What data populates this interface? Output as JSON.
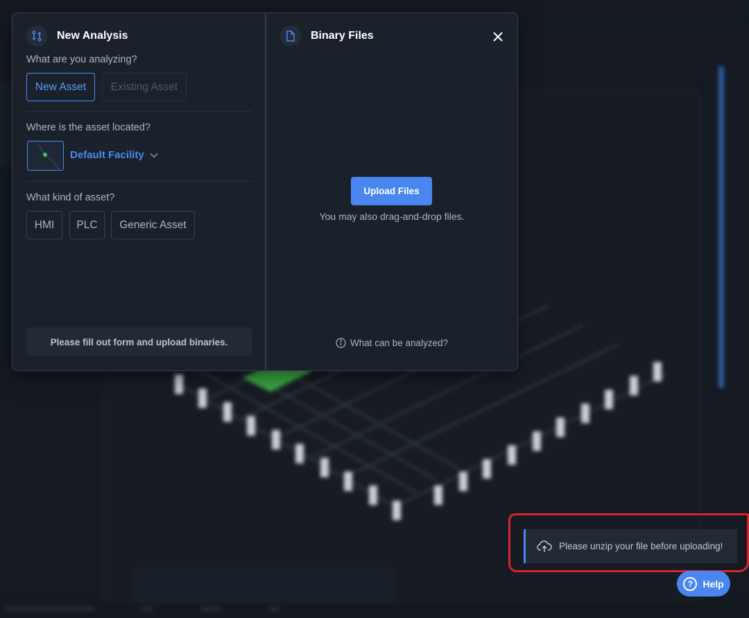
{
  "modal": {
    "left": {
      "title": "New Analysis",
      "q_analyzing": "What are you analyzing?",
      "new_asset_label": "New Asset",
      "existing_asset_label": "Existing Asset",
      "q_location": "Where is the asset located?",
      "facility_label": "Default Facility",
      "q_kind": "What kind of asset?",
      "asset_types": [
        "HMI",
        "PLC",
        "Generic Asset"
      ],
      "status_text": "Please fill out form and upload binaries."
    },
    "right": {
      "title": "Binary Files",
      "upload_label": "Upload Files",
      "drag_hint": "You may also drag-and-drop files.",
      "info_link": "What can be analyzed?"
    }
  },
  "toast": {
    "message": "Please unzip your file before uploading!"
  },
  "help": {
    "label": "Help",
    "icon_glyph": "?"
  },
  "colors": {
    "accent": "#4a86f0",
    "highlight": "#d9232e",
    "background": "#151a22",
    "modal": "#1b212b"
  }
}
